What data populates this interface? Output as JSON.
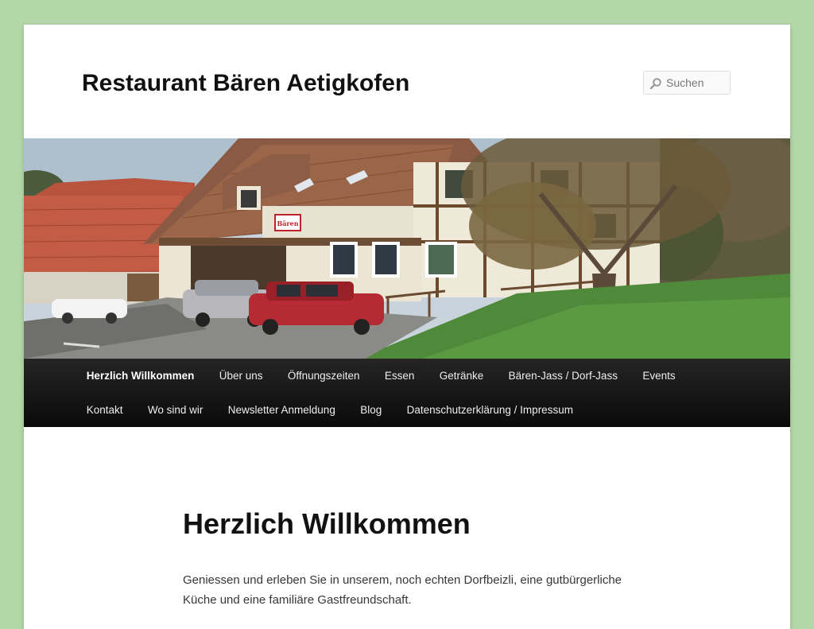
{
  "site": {
    "title": "Restaurant Bären Aetigkofen"
  },
  "search": {
    "placeholder": "Suchen",
    "icon": "search-icon"
  },
  "header_image": {
    "sign_text": "Bären"
  },
  "nav": {
    "row1": [
      {
        "label": "Herzlich Willkommen",
        "active": true
      },
      {
        "label": "Über uns"
      },
      {
        "label": "Öffnungszeiten"
      },
      {
        "label": "Essen"
      },
      {
        "label": "Getränke"
      },
      {
        "label": "Bären-Jass / Dorf-Jass"
      },
      {
        "label": "Events"
      }
    ],
    "row2": [
      {
        "label": "Kontakt"
      },
      {
        "label": "Wo sind wir"
      },
      {
        "label": "Newsletter Anmeldung"
      },
      {
        "label": "Blog"
      },
      {
        "label": "Datenschutzerklärung / Impressum"
      }
    ]
  },
  "content": {
    "title": "Herzlich Willkommen",
    "paragraph": "Geniessen und erleben Sie in unserem, noch echten Dorfbeizli, eine gutbürgerliche Küche und eine familiäre Gastfreundschaft."
  },
  "colors": {
    "background": "#b4d7a8",
    "nav_bar": "#1a1a1a",
    "accent_sign": "#c0232d"
  }
}
